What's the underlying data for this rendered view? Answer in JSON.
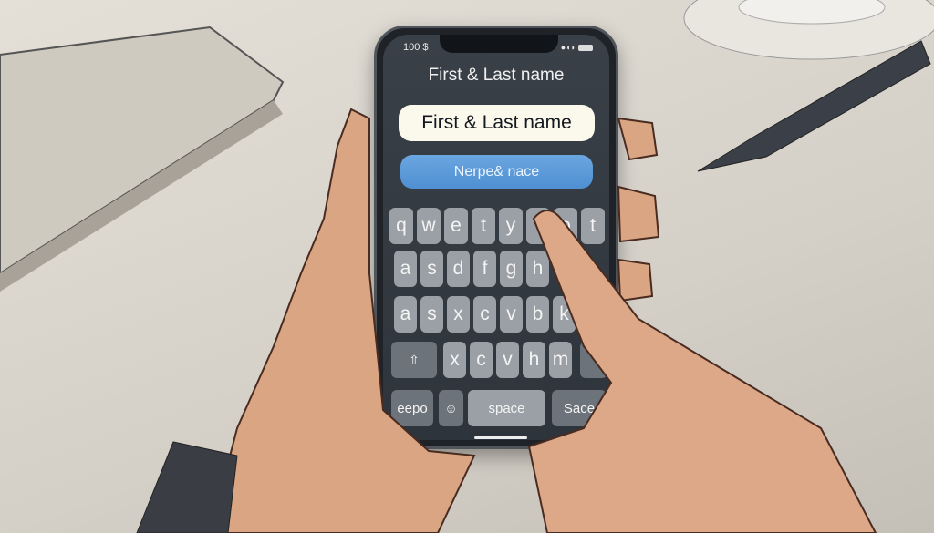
{
  "status_bar": {
    "left": "100 $",
    "right_icons": [
      "signal-icon",
      "battery-icon"
    ]
  },
  "form": {
    "title": "First & Last name",
    "field_value": "First & Last name",
    "button_label": "Nerpe& nace",
    "button_color": "#5b9ad8"
  },
  "keyboard": {
    "row1": [
      "q",
      "w",
      "e",
      "t",
      "y",
      "",
      "o",
      "t"
    ],
    "row2": [
      "a",
      "s",
      "d",
      "f",
      "g",
      "h"
    ],
    "row3": [
      "a",
      "s",
      "x",
      "c",
      "v",
      "b",
      "k"
    ],
    "row4": [
      "x",
      "c",
      "v",
      "h",
      "m"
    ],
    "bottom": {
      "left": "eepo",
      "space": "space",
      "right": "Sace"
    }
  }
}
